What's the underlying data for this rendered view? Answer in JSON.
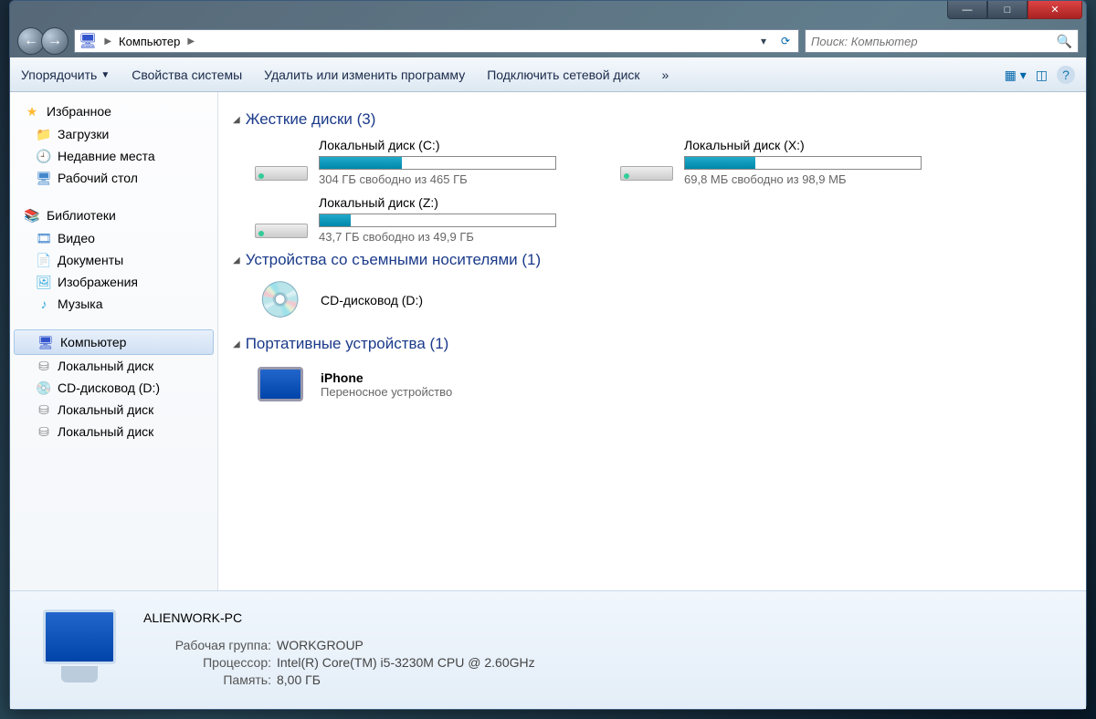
{
  "titlebar": {
    "min": "—",
    "max": "□",
    "close": "✕"
  },
  "nav": {
    "back": "←",
    "fwd": "→"
  },
  "address": {
    "root": "Компьютер"
  },
  "search": {
    "placeholder": "Поиск: Компьютер"
  },
  "toolbar": {
    "organize": "Упорядочить",
    "sysprops": "Свойства системы",
    "uninstall": "Удалить или изменить программу",
    "mapdrive": "Подключить сетевой диск",
    "more": "»"
  },
  "sidebar": {
    "fav": "Избранное",
    "downloads": "Загрузки",
    "recent": "Недавние места",
    "desktop": "Рабочий стол",
    "libs": "Библиотеки",
    "video": "Видео",
    "docs": "Документы",
    "images": "Изображения",
    "music": "Музыка",
    "computer": "Компьютер",
    "localdisk": "Локальный диск",
    "cddrive": "CD-дисковод (D:)"
  },
  "sections": {
    "hdd": "Жесткие диски (3)",
    "removable": "Устройства со съемными носителями (1)",
    "portable": "Портативные устройства (1)"
  },
  "drives": {
    "c": {
      "name": "Локальный диск (C:)",
      "stat": "304 ГБ свободно из 465 ГБ",
      "fill": 35
    },
    "x": {
      "name": "Локальный диск (X:)",
      "stat": "69,8 МБ свободно из 98,9 МБ",
      "fill": 30
    },
    "z": {
      "name": "Локальный диск (Z:)",
      "stat": "43,7 ГБ свободно из 49,9 ГБ",
      "fill": 13
    }
  },
  "cd": {
    "name": "CD-дисковод (D:)"
  },
  "portable": {
    "name": "iPhone",
    "sub": "Переносное устройство"
  },
  "details": {
    "pcname": "ALIENWORK-PC",
    "wg_k": "Рабочая группа:",
    "wg_v": "WORKGROUP",
    "cpu_k": "Процессор:",
    "cpu_v": "Intel(R) Core(TM) i5-3230M CPU @ 2.60GHz",
    "mem_k": "Память:",
    "mem_v": "8,00 ГБ"
  }
}
